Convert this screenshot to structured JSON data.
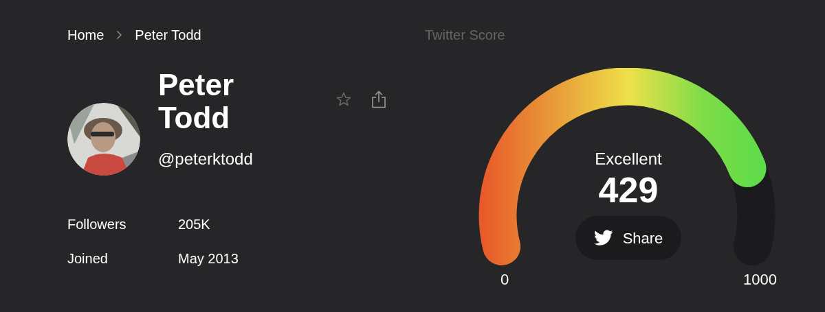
{
  "breadcrumb": [
    {
      "label": "Home"
    },
    {
      "label": "Peter Todd"
    }
  ],
  "profile": {
    "name": "Peter Todd",
    "handle": "@peterktodd"
  },
  "stats": [
    {
      "label": "Followers",
      "value": "205K"
    },
    {
      "label": "Joined",
      "value": "May 2013"
    }
  ],
  "score_panel": {
    "title": "Twitter Score",
    "gauge": {
      "rating": "Excellent",
      "score": "429",
      "min_label": "0",
      "max_label": "1000"
    },
    "share_button": {
      "label": "Share"
    }
  }
}
